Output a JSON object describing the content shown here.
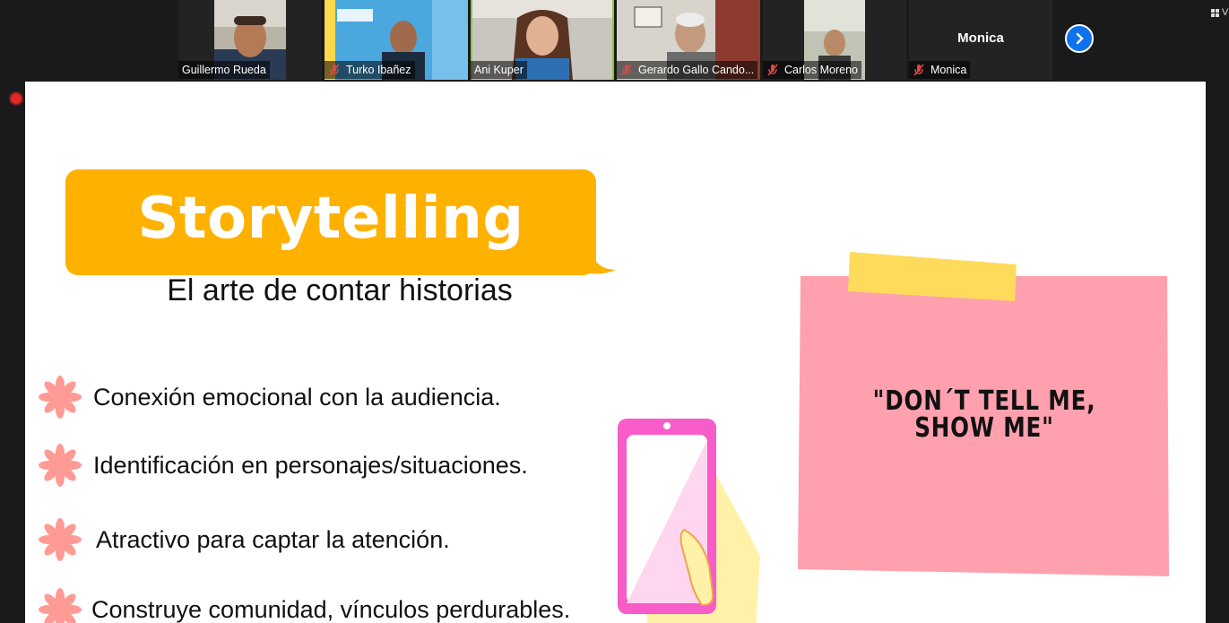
{
  "participants": [
    {
      "name": "Guillermo Rueda",
      "muted": false,
      "active": false
    },
    {
      "name": "Turko Ibañez",
      "muted": true,
      "active": false
    },
    {
      "name": "Ani Kuper",
      "muted": false,
      "active": true
    },
    {
      "name": "Gerardo Gallo Cando...",
      "muted": true,
      "active": false
    },
    {
      "name": "Carlos Moreno",
      "muted": true,
      "active": false
    },
    {
      "name": "Monica",
      "muted": true,
      "active": false,
      "avatar_text": "Monica"
    }
  ],
  "icons": {
    "muted": "mic-muted-icon",
    "next": "chevron-right-icon",
    "recording": "recording-dot-icon",
    "bullet": "flower-icon"
  },
  "slide": {
    "title": "Storytelling",
    "subtitle": "El arte de contar historias",
    "bullets": [
      "Conexión emocional con la audiencia.",
      "Identificación en personajes/situaciones.",
      "Atractivo para captar la atención.",
      "Construye comunidad, vínculos perdurables."
    ],
    "quote_line1": "\"DON´T TELL ME,",
    "quote_line2": "SHOW ME\""
  },
  "colors": {
    "title_bubble": "#ffb100",
    "note": "#ffa0ae",
    "tape": "#ffdb5c",
    "bullet": "#ff9a94",
    "phone": "#f75cc8",
    "accent": "#0e72ed"
  },
  "view_label": "V"
}
